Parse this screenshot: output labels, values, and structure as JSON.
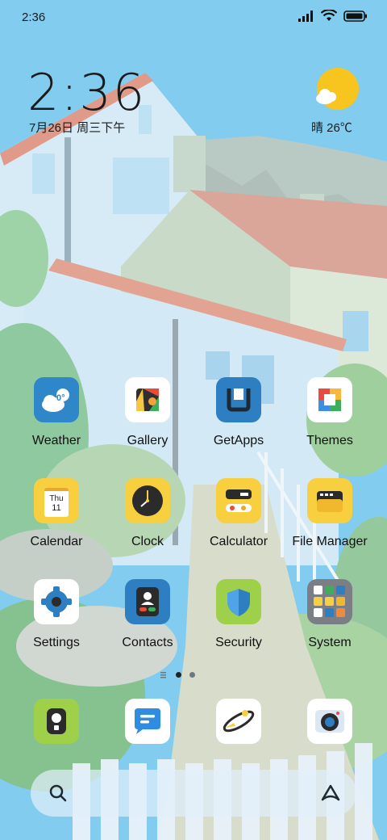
{
  "status_bar": {
    "time": "2:36",
    "icons": [
      "signal-icon",
      "wifi-icon",
      "battery-icon"
    ]
  },
  "clock_widget": {
    "time": "2:36",
    "date": "7月26日 周三下午"
  },
  "weather_widget": {
    "condition_icon": "partly-sunny-icon",
    "text": "晴 26℃"
  },
  "apps": [
    {
      "label": "Weather",
      "icon": "weather-icon",
      "badge": "0°"
    },
    {
      "label": "Gallery",
      "icon": "gallery-icon"
    },
    {
      "label": "GetApps",
      "icon": "getapps-icon"
    },
    {
      "label": "Themes",
      "icon": "themes-icon"
    },
    {
      "label": "Calendar",
      "icon": "calendar-icon",
      "day": "Thu",
      "date": "11"
    },
    {
      "label": "Clock",
      "icon": "clock-icon"
    },
    {
      "label": "Calculator",
      "icon": "calculator-icon"
    },
    {
      "label": "File Manager",
      "icon": "file-manager-icon"
    },
    {
      "label": "Settings",
      "icon": "settings-gear-icon"
    },
    {
      "label": "Contacts",
      "icon": "contacts-icon"
    },
    {
      "label": "Security",
      "icon": "security-shield-icon"
    },
    {
      "label": "System",
      "icon": "system-folder-icon"
    }
  ],
  "dock": [
    {
      "icon": "phone-icon"
    },
    {
      "icon": "messages-icon"
    },
    {
      "icon": "browser-icon"
    },
    {
      "icon": "camera-icon"
    }
  ],
  "page_indicator": {
    "pages": 2,
    "active": 1
  },
  "search_bar": {
    "left_icon": "search-icon",
    "right_icon": "assistant-icon"
  },
  "colors": {
    "sky": "#7ec8ee",
    "sun": "#f7c51e",
    "accent_blue": "#2e7fc2",
    "yellow_icon": "#f8cf3f"
  }
}
